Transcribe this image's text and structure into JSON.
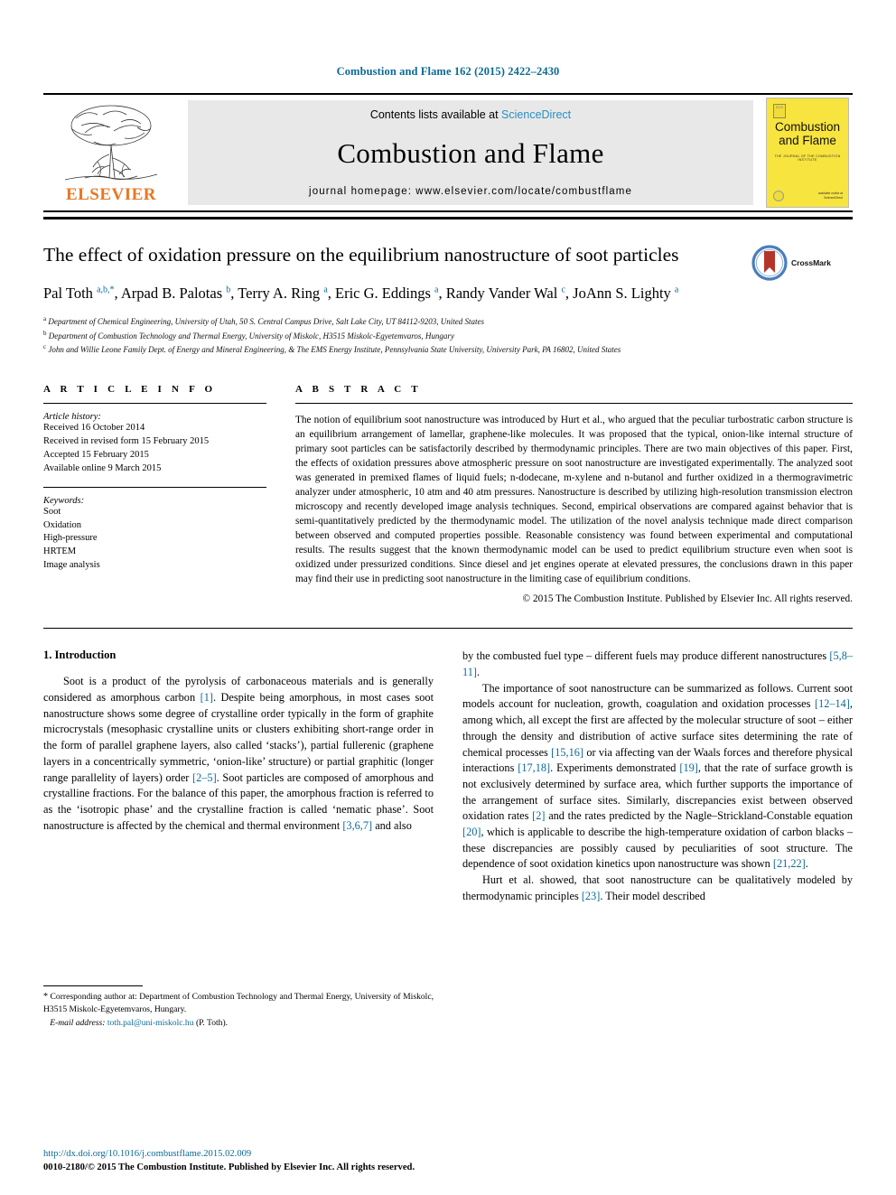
{
  "running_head": "Combustion and Flame 162 (2015) 2422–2430",
  "masthead": {
    "contents_prefix": "Contents lists available at ",
    "contents_link": "ScienceDirect",
    "journal_title": "Combustion and Flame",
    "homepage": "journal homepage: www.elsevier.com/locate/combustflame",
    "publisher_name": "ELSEVIER",
    "cover": {
      "title_line1": "Combustion",
      "title_line2": "and Flame",
      "subtitle": "THE JOURNAL OF THE COMBUSTION INSTITUTE",
      "footer": "available online at\nScienceDirect"
    }
  },
  "article": {
    "title": "The effect of oxidation pressure on the equilibrium nanostructure of soot particles",
    "crossmark_label": "CrossMark",
    "authors_html": "Pal Toth <sup>a,b,</sup><sup>*</sup>, Arpad B. Palotas <sup>b</sup>, Terry A. Ring <sup>a</sup>, Eric G. Eddings <sup>a</sup>, Randy Vander Wal <sup>c</sup>, JoAnn S. Lighty <sup>a</sup>",
    "affiliations": [
      "Department of Chemical Engineering, University of Utah, 50 S. Central Campus Drive, Salt Lake City, UT 84112-9203, United States",
      "Department of Combustion Technology and Thermal Energy, University of Miskolc, H3515 Miskolc-Egyetemvaros, Hungary",
      "John and Willie Leone Family Dept. of Energy and Mineral Engineering, & The EMS Energy Institute, Pennsylvania State University, University Park, PA 16802, United States"
    ],
    "affiliation_marks": [
      "a",
      "b",
      "c"
    ]
  },
  "article_info": {
    "heading": "A R T I C L E  I N F O",
    "history_title": "Article history:",
    "history": [
      "Received 16 October 2014",
      "Received in revised form 15 February 2015",
      "Accepted 15 February 2015",
      "Available online 9 March 2015"
    ],
    "keywords_title": "Keywords:",
    "keywords": [
      "Soot",
      "Oxidation",
      "High-pressure",
      "HRTEM",
      "Image analysis"
    ]
  },
  "abstract": {
    "heading": "A B S T R A C T",
    "text": "The notion of equilibrium soot nanostructure was introduced by Hurt et al., who argued that the peculiar turbostratic carbon structure is an equilibrium arrangement of lamellar, graphene-like molecules. It was proposed that the typical, onion-like internal structure of primary soot particles can be satisfactorily described by thermodynamic principles. There are two main objectives of this paper. First, the effects of oxidation pressures above atmospheric pressure on soot nanostructure are investigated experimentally. The analyzed soot was generated in premixed flames of liquid fuels; n-dodecane, m-xylene and n-butanol and further oxidized in a thermogravimetric analyzer under atmospheric, 10 atm and 40 atm pressures. Nanostructure is described by utilizing high-resolution transmission electron microscopy and recently developed image analysis techniques. Second, empirical observations are compared against behavior that is semi-quantitatively predicted by the thermodynamic model. The utilization of the novel analysis technique made direct comparison between observed and computed properties possible. Reasonable consistency was found between experimental and computational results. The results suggest that the known thermodynamic model can be used to predict equilibrium structure even when soot is oxidized under pressurized conditions. Since diesel and jet engines operate at elevated pressures, the conclusions drawn in this paper may find their use in predicting soot nanostructure in the limiting case of equilibrium conditions.",
    "copyright": "© 2015 The Combustion Institute. Published by Elsevier Inc. All rights reserved."
  },
  "body": {
    "section_title": "1. Introduction",
    "left_para_1_html": "Soot is a product of the pyrolysis of carbonaceous materials and is generally considered as amorphous carbon <span class=\"ref\">[1]</span>. Despite being amorphous, in most cases soot nanostructure shows some degree of crystalline order typically in the form of graphite microcrystals (mesophasic crystalline units or clusters exhibiting short-range order in the form of parallel graphene layers, also called ‘stacks’), partial fullerenic (graphene layers in a concentrically symmetric, ‘onion-like’ structure) or partial graphitic (longer range parallelity of layers) order <span class=\"ref\">[2–5]</span>. Soot particles are composed of amorphous and crystalline fractions. For the balance of this paper, the amorphous fraction is referred to as the ‘isotropic phase’ and the crystalline fraction is called ‘nematic phase’. Soot nanostructure is affected by the chemical and thermal environment <span class=\"ref\">[3,6,7]</span> and also",
    "right_para_1_html": "by the combusted fuel type – different fuels may produce different nanostructures <span class=\"ref\">[5,8–11]</span>.",
    "right_para_2_html": "The importance of soot nanostructure can be summarized as follows. Current soot models account for nucleation, growth, coagulation and oxidation processes <span class=\"ref\">[12–14]</span>, among which, all except the first are affected by the molecular structure of soot – either through the density and distribution of active surface sites determining the rate of chemical processes <span class=\"ref\">[15,16]</span> or via affecting van der Waals forces and therefore physical interactions <span class=\"ref\">[17,18]</span>. Experiments demonstrated <span class=\"ref\">[19]</span>, that the rate of surface growth is not exclusively determined by surface area, which further supports the importance of the arrangement of surface sites. Similarly, discrepancies exist between observed oxidation rates <span class=\"ref\">[2]</span> and the rates predicted by the Nagle–Strickland-Constable equation <span class=\"ref\">[20]</span>, which is applicable to describe the high-temperature oxidation of carbon blacks – these discrepancies are possibly caused by peculiarities of soot structure. The dependence of soot oxidation kinetics upon nanostructure was shown <span class=\"ref\">[21,22]</span>.",
    "right_para_3_html": "Hurt et al. showed, that soot nanostructure can be qualitatively modeled by thermodynamic principles <span class=\"ref\">[23]</span>. Their model described"
  },
  "footnote": {
    "star": "*",
    "corresponding_text": "Corresponding author at: Department of Combustion Technology and Thermal Energy, University of Miskolc, H3515 Miskolc-Egyetemvaros, Hungary.",
    "email_label": "E-mail address:",
    "email": "toth.pal@uni-miskolc.hu",
    "email_suffix": "(P. Toth)."
  },
  "doi_block": {
    "doi": "http://dx.doi.org/10.1016/j.combustflame.2015.02.009",
    "issn": "0010-2180/© 2015 The Combustion Institute. Published by Elsevier Inc. All rights reserved."
  },
  "colors": {
    "link_blue": "#0b6a96",
    "sciencedirect_blue": "#2b8fc4",
    "elsevier_orange": "#e87722",
    "cover_yellow": "#f7e43f",
    "crossmark_blue": "#4a7ebb",
    "crossmark_red": "#b5342a"
  }
}
